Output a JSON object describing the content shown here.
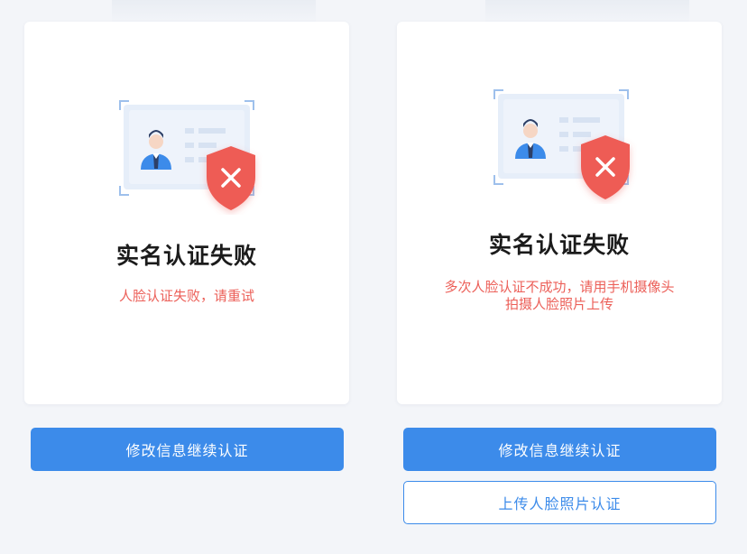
{
  "left_screen": {
    "title": "实名认证失败",
    "message": "人脸认证失败，请重试",
    "primary_button": "修改信息继续认证"
  },
  "right_screen": {
    "title": "实名认证失败",
    "message_line1": "多次人脸认证不成功，请用手机摄像头",
    "message_line2": "拍摄人脸照片上传",
    "primary_button": "修改信息继续认证",
    "secondary_button": "上传人脸照片认证"
  },
  "icons": {
    "illustration": "id-card-verification-failed-icon",
    "badge": "shield-x-icon"
  },
  "colors": {
    "primary": "#3c8bea",
    "error": "#ec6059",
    "background": "#f3f5f9"
  }
}
